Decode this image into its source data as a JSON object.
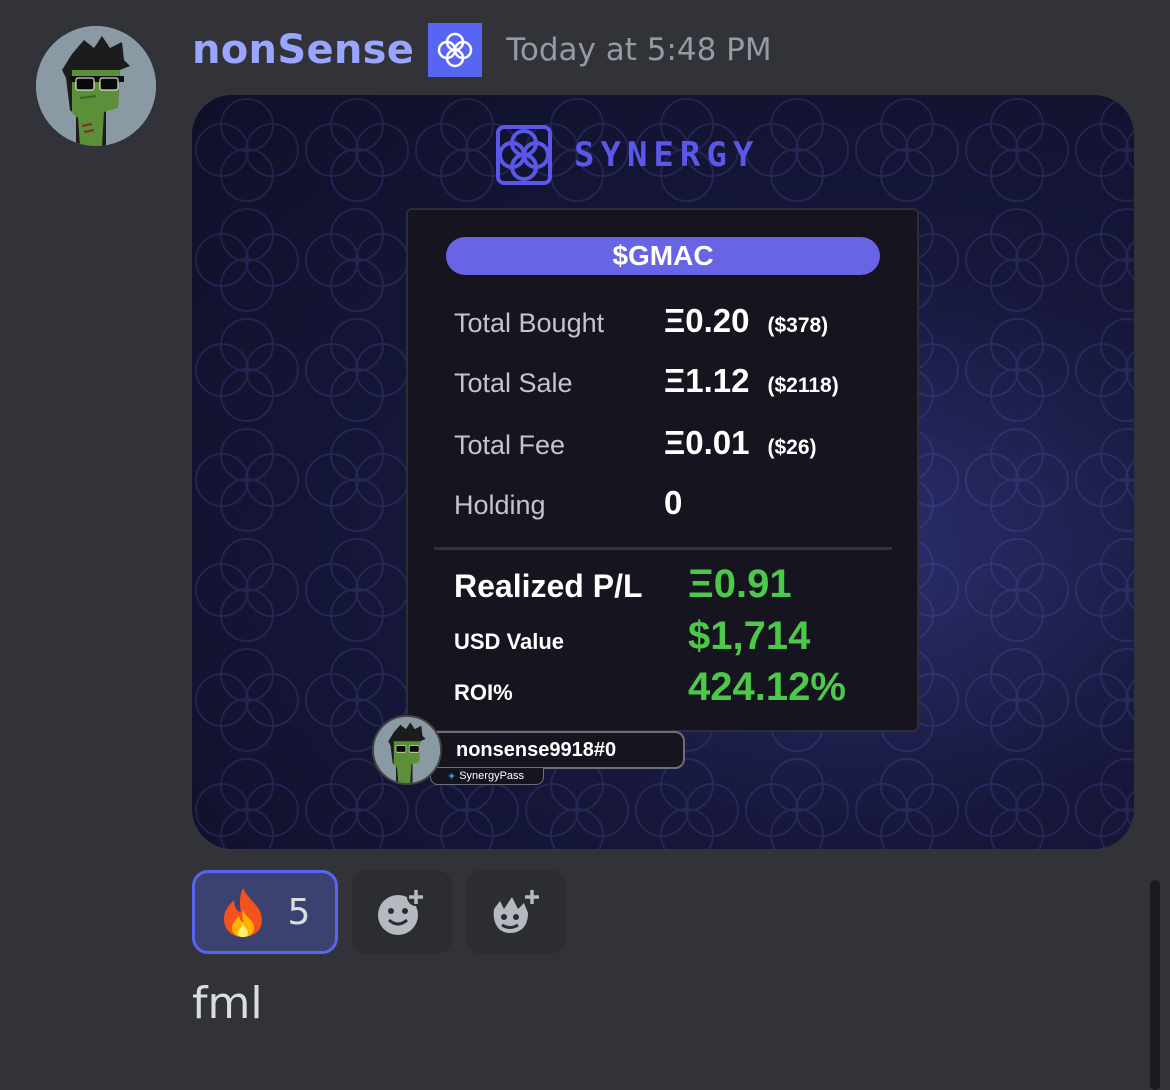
{
  "message": {
    "author": "nonSense",
    "timestamp": "Today at 5:48 PM",
    "text": "fml"
  },
  "embed": {
    "brand": "SYNERGY",
    "ticker": "$GMAC",
    "rows": [
      {
        "label": "Total Bought",
        "eth": "Ξ0.20",
        "usd": "($378)"
      },
      {
        "label": "Total Sale",
        "eth": "Ξ1.12",
        "usd": "($2118)"
      },
      {
        "label": "Total Fee",
        "eth": "Ξ0.01",
        "usd": "($26)"
      },
      {
        "label": "Holding",
        "eth": "0",
        "usd": ""
      }
    ],
    "realized_label": "Realized P/L",
    "realized_value": "Ξ0.91",
    "usd_label": "USD Value",
    "usd_value": "$1,714",
    "roi_label": "ROI%",
    "roi_value": "424.12%",
    "user_handle": "nonsense9918#0",
    "twitter_handle": "SynergyPass"
  },
  "reactions": [
    {
      "icon": "fire-emoji",
      "count": "5",
      "active": true
    },
    {
      "icon": "add-reaction-icon"
    },
    {
      "icon": "add-super-reaction-icon"
    }
  ],
  "colors": {
    "username": "#9aa5ff",
    "accent": "#5865f2",
    "profit_green": "#4cc94a",
    "ticker_bg": "#6765e6"
  }
}
